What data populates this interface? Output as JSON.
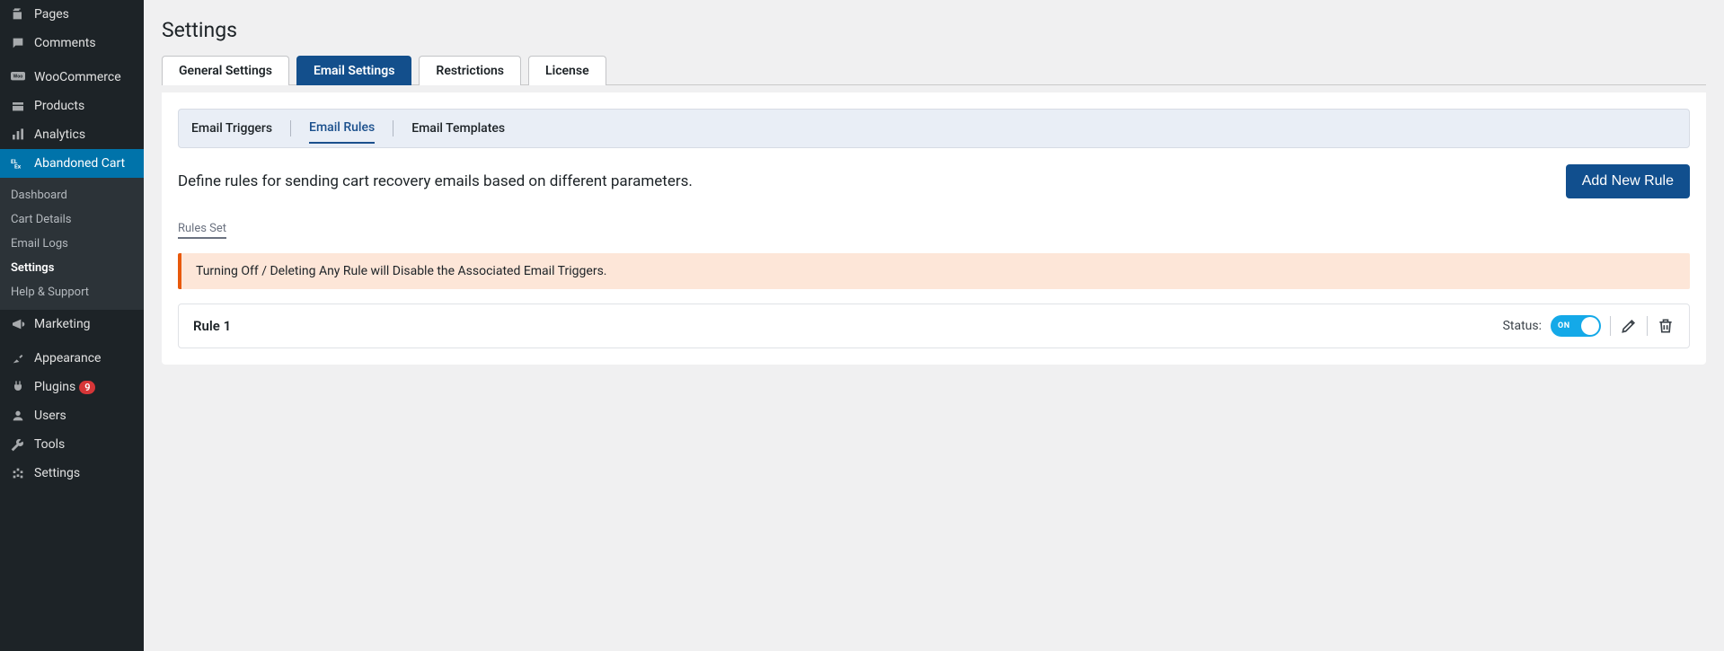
{
  "sidebar": {
    "items": [
      {
        "label": "Pages"
      },
      {
        "label": "Comments"
      },
      {
        "label": "WooCommerce"
      },
      {
        "label": "Products"
      },
      {
        "label": "Analytics"
      },
      {
        "label": "Abandoned Cart"
      },
      {
        "label": "Marketing"
      },
      {
        "label": "Appearance"
      },
      {
        "label": "Plugins",
        "badge": "9"
      },
      {
        "label": "Users"
      },
      {
        "label": "Tools"
      },
      {
        "label": "Settings"
      }
    ],
    "sub": [
      {
        "label": "Dashboard"
      },
      {
        "label": "Cart Details"
      },
      {
        "label": "Email Logs"
      },
      {
        "label": "Settings"
      },
      {
        "label": "Help & Support"
      }
    ]
  },
  "page": {
    "title": "Settings",
    "tabs": [
      {
        "label": "General Settings"
      },
      {
        "label": "Email Settings"
      },
      {
        "label": "Restrictions"
      },
      {
        "label": "License"
      }
    ],
    "subnav": [
      {
        "label": "Email Triggers"
      },
      {
        "label": "Email Rules"
      },
      {
        "label": "Email Templates"
      }
    ],
    "description": "Define rules for sending cart recovery emails based on different parameters.",
    "add_button": "Add New Rule",
    "rules_set_label": "Rules Set",
    "notice": "Turning Off / Deleting Any Rule will Disable the Associated Email Triggers.",
    "rule": {
      "title": "Rule 1",
      "status_label": "Status:",
      "toggle_on": "ON"
    }
  }
}
